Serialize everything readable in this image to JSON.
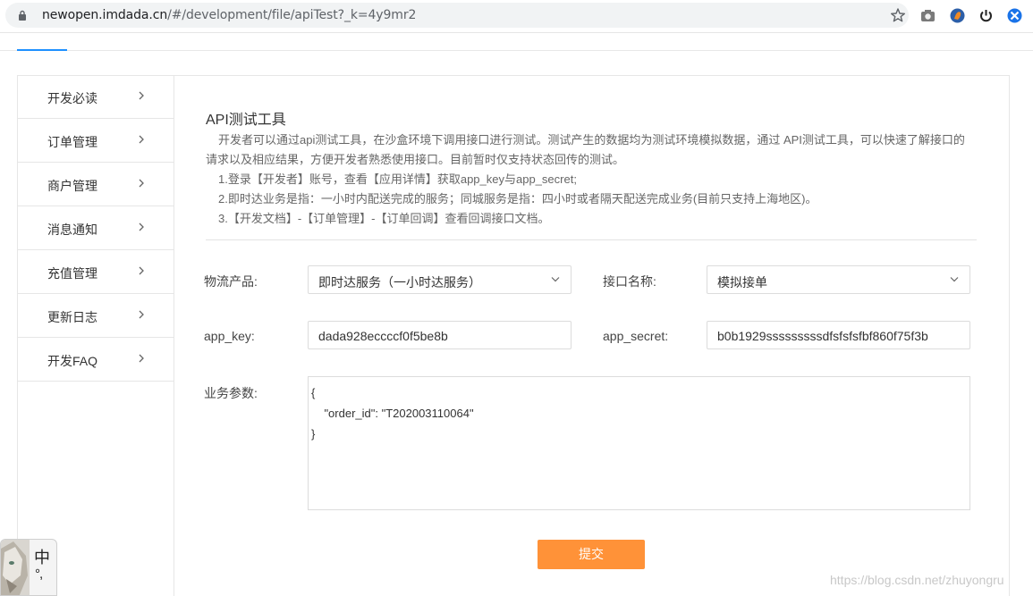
{
  "browser": {
    "url_host": "newopen.imdada.cn",
    "url_rest": "/#/development/file/apiTest?_k=4y9mr2"
  },
  "sidebar": {
    "items": [
      {
        "label": "开发必读"
      },
      {
        "label": "订单管理"
      },
      {
        "label": "商户管理"
      },
      {
        "label": "消息通知"
      },
      {
        "label": "充值管理"
      },
      {
        "label": "更新日志"
      },
      {
        "label": "开发FAQ"
      }
    ]
  },
  "main": {
    "title": "API测试工具",
    "desc_line1": "开发者可以通过api测试工具，在沙盒环境下调用接口进行测试。测试产生的数据均为测试环境模拟数据，通过 API测试工具，可以快速了解接口的",
    "desc_line2": "请求以及相应结果，方便开发者熟悉使用接口。目前暂时仅支持状态回传的测试。",
    "desc_line3": "1.登录【开发者】账号，查看【应用详情】获取app_key与app_secret;",
    "desc_line4": "2.即时达业务是指：一小时内配送完成的服务；同城服务是指：四小时或者隔天配送完成业务(目前只支持上海地区)。",
    "desc_line5": "3.【开发文档】-【订单管理】-【订单回调】查看回调接口文档。"
  },
  "form": {
    "product_label": "物流产品:",
    "product_value": "即时达服务（一小时达服务）",
    "api_label": "接口名称:",
    "api_value": "模拟接单",
    "app_key_label": "app_key:",
    "app_key_value": "dada928eccccf0f5be8b",
    "app_secret_label": "app_secret:",
    "app_secret_value": "b0b1929sssssssssdfsfsfsfbf860f75f3b",
    "params_label": "业务参数:",
    "params_value": "{\n    \"order_id\": \"T202003110064\"\n}",
    "submit_label": "提交"
  },
  "watermark": "https://blog.csdn.net/zhuyongru",
  "ime": {
    "lang": "中",
    "punc": "°,"
  },
  "colors": {
    "accent": "#ff9238",
    "tab_active": "#1e90ff"
  }
}
